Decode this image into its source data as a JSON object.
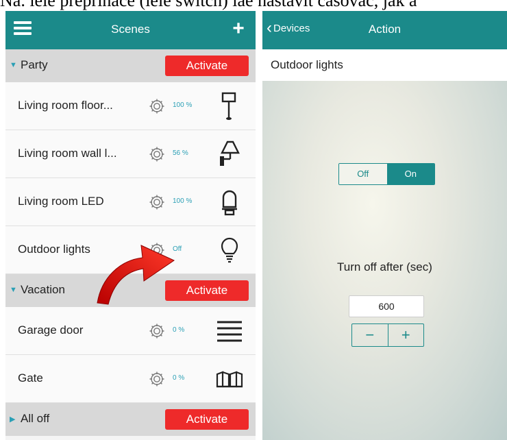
{
  "caption": "Na. ieie preprinace (ieie switch) iae nastavit casovac, jak a",
  "left_panel": {
    "title": "Scenes",
    "plus": "+",
    "scenes": [
      {
        "name": "Party",
        "activate": "Activate",
        "devices": [
          {
            "label": "Living room floor...",
            "value": "100 %",
            "icon": "floor-lamp-icon"
          },
          {
            "label": "Living room wall l...",
            "value": "56 %",
            "icon": "wall-lamp-icon"
          },
          {
            "label": "Living room LED",
            "value": "100 %",
            "icon": "led-bulb-icon"
          },
          {
            "label": "Outdoor lights",
            "value": "Off",
            "icon": "light-bulb-icon"
          }
        ]
      },
      {
        "name": "Vacation",
        "activate": "Activate",
        "devices": [
          {
            "label": "Garage door",
            "value": "0 %",
            "icon": "garage-door-icon"
          },
          {
            "label": "Gate",
            "value": "0 %",
            "icon": "gate-icon"
          }
        ]
      },
      {
        "name": "All off",
        "activate": "Activate",
        "devices": []
      }
    ]
  },
  "right_panel": {
    "back_label": "Devices",
    "title": "Action",
    "device_name": "Outdoor lights",
    "toggle": {
      "off": "Off",
      "on": "On",
      "selected": "On"
    },
    "timer_label": "Turn off after (sec)",
    "timer_value": "600",
    "minus": "−",
    "plus": "+"
  },
  "colors": {
    "accent": "#1b8a8a",
    "activate": "#ee2a2a",
    "value_text": "#2a9fb5"
  }
}
